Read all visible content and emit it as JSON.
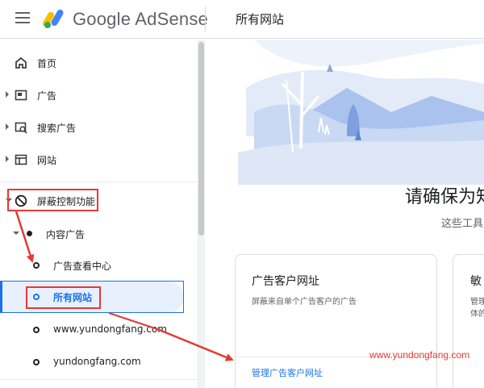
{
  "header": {
    "brand_google": "Google",
    "brand_product": "AdSense",
    "page_title": "所有网站"
  },
  "sidebar": {
    "items": [
      {
        "label": "首页",
        "icon": "home-icon"
      },
      {
        "label": "广告",
        "icon": "ad-unit-icon"
      },
      {
        "label": "搜索广告",
        "icon": "search-ads-icon"
      },
      {
        "label": "网站",
        "icon": "web-icon"
      },
      {
        "label": "屏蔽控制功能",
        "icon": "block-icon"
      },
      {
        "label": "内容广告"
      },
      {
        "label": "广告查看中心"
      },
      {
        "label": "所有网站"
      },
      {
        "label": "www.yundongfang.com"
      },
      {
        "label": "yundongfang.com"
      }
    ]
  },
  "main": {
    "headline": "请确保为知",
    "subline": "这些工具",
    "card1": {
      "title": "广告客户网址",
      "description": "屏蔽来自单个广告客户的广告",
      "link": "管理广告客户网址"
    },
    "card2": {
      "title": "敏",
      "desc_line1": "管理",
      "desc_line2": "体的"
    }
  },
  "watermark": "www.yundongfang.com",
  "colors": {
    "accent": "#1a73e8",
    "annotation_red": "#e53935",
    "active_bg": "#e8f0fe"
  }
}
